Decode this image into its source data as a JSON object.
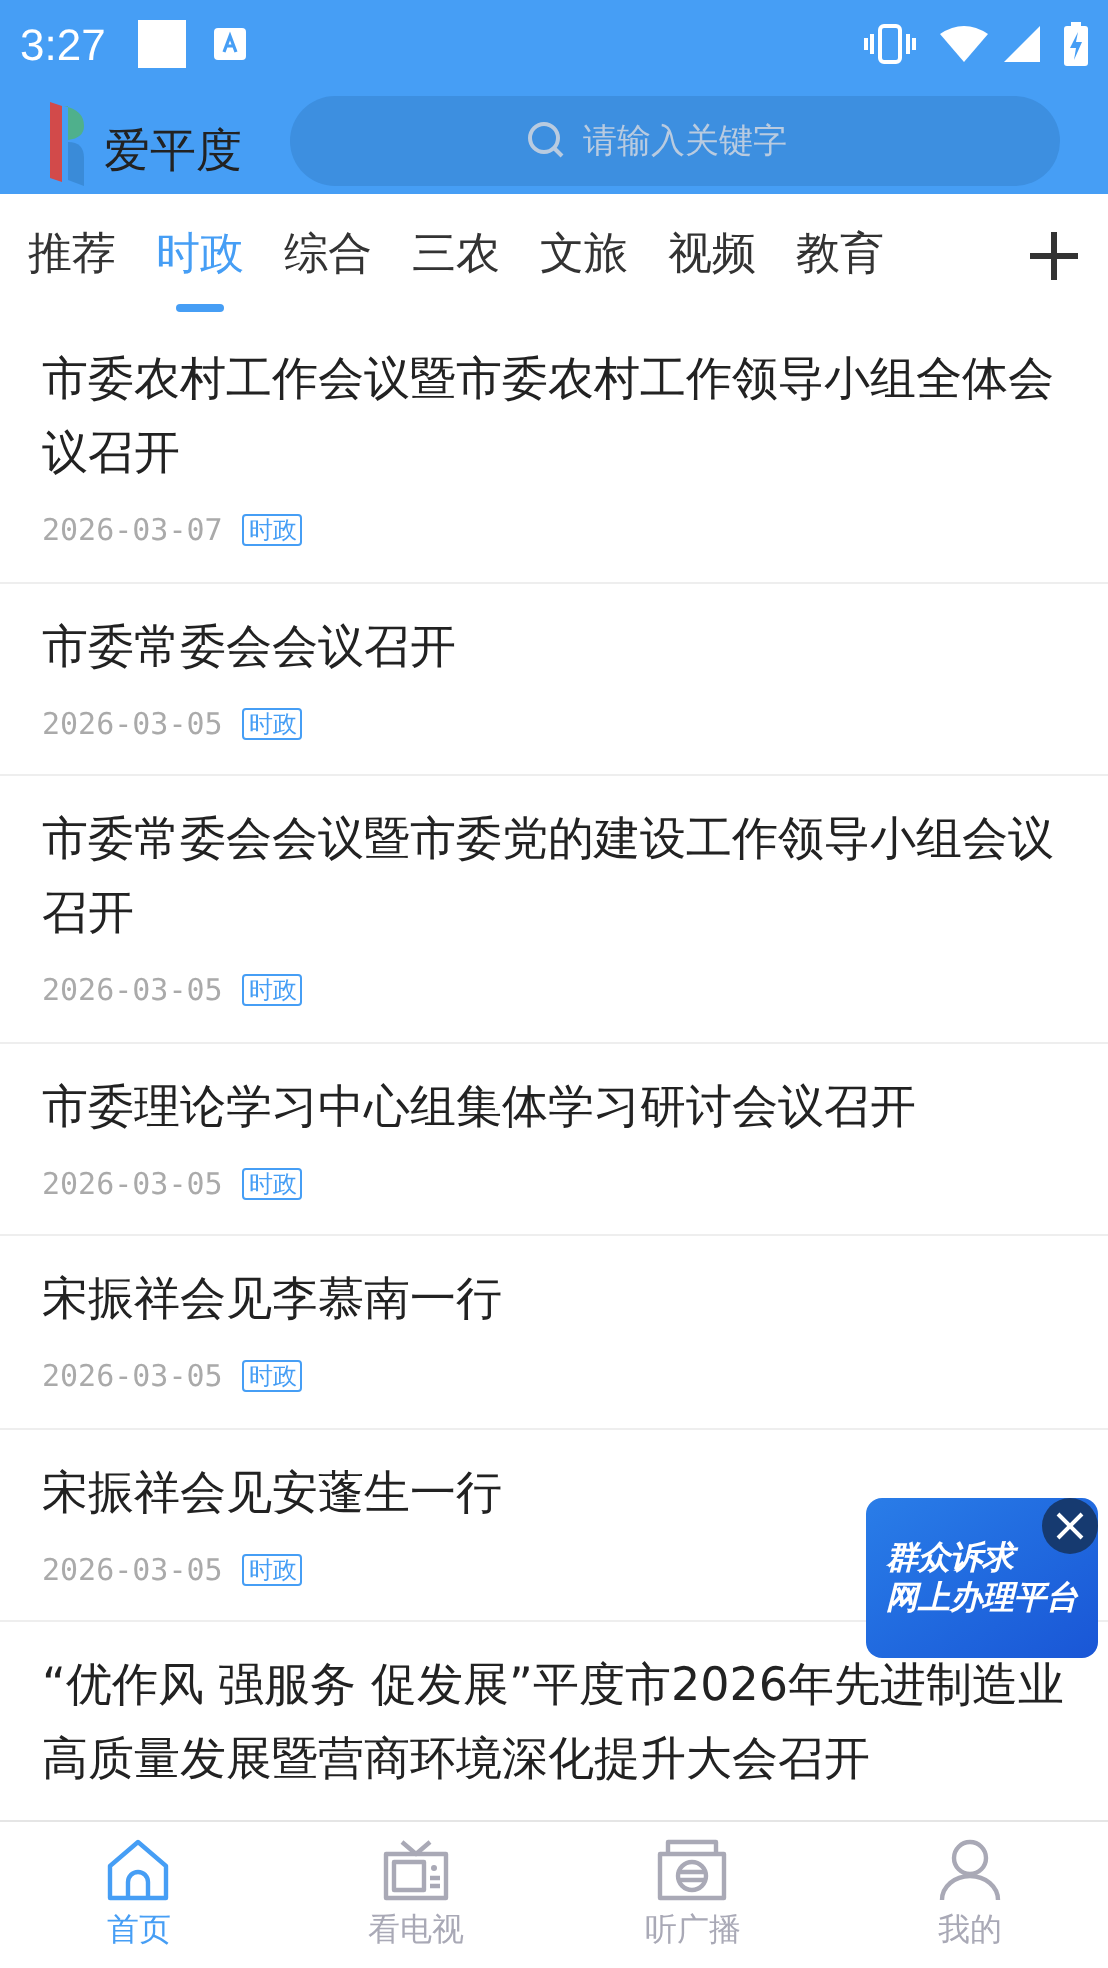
{
  "status_bar": {
    "time": "3:27"
  },
  "header": {
    "app_name": "爱平度",
    "search": {
      "placeholder": "请输入关键字"
    }
  },
  "tabs": [
    {
      "label": "推荐",
      "selected": false
    },
    {
      "label": "时政",
      "selected": true
    },
    {
      "label": "综合",
      "selected": false
    },
    {
      "label": "三农",
      "selected": false
    },
    {
      "label": "文旅",
      "selected": false
    },
    {
      "label": "视频",
      "selected": false
    },
    {
      "label": "教育",
      "selected": false
    }
  ],
  "articles": [
    {
      "title": "市委农村工作会议暨市委农村工作领导小组全体会议召开",
      "date": "2026-03-07",
      "tag": "时政"
    },
    {
      "title": "市委常委会会议召开",
      "date": "2026-03-05",
      "tag": "时政"
    },
    {
      "title": "市委常委会会议暨市委党的建设工作领导小组会议召开",
      "date": "2026-03-05",
      "tag": "时政"
    },
    {
      "title": "市委理论学习中心组集体学习研讨会议召开",
      "date": "2026-03-05",
      "tag": "时政"
    },
    {
      "title": "宋振祥会见李慕南一行",
      "date": "2026-03-05",
      "tag": "时政"
    },
    {
      "title": "宋振祥会见安蓬生一行",
      "date": "2026-03-05",
      "tag": "时政"
    },
    {
      "title": "“优作风  强服务  促发展”平度市2026年先进制造业高质量发展暨营商环境深化提升大会召开"
    }
  ],
  "floating_banner": {
    "line_1": "群众诉求",
    "line_2": "网上办理平台"
  },
  "bottom_nav": [
    {
      "label": "首页",
      "kind": "home",
      "selected": true
    },
    {
      "label": "看电视",
      "kind": "tv",
      "selected": false
    },
    {
      "label": "听广播",
      "kind": "radio",
      "selected": false
    },
    {
      "label": "我的",
      "kind": "user",
      "selected": false
    }
  ]
}
